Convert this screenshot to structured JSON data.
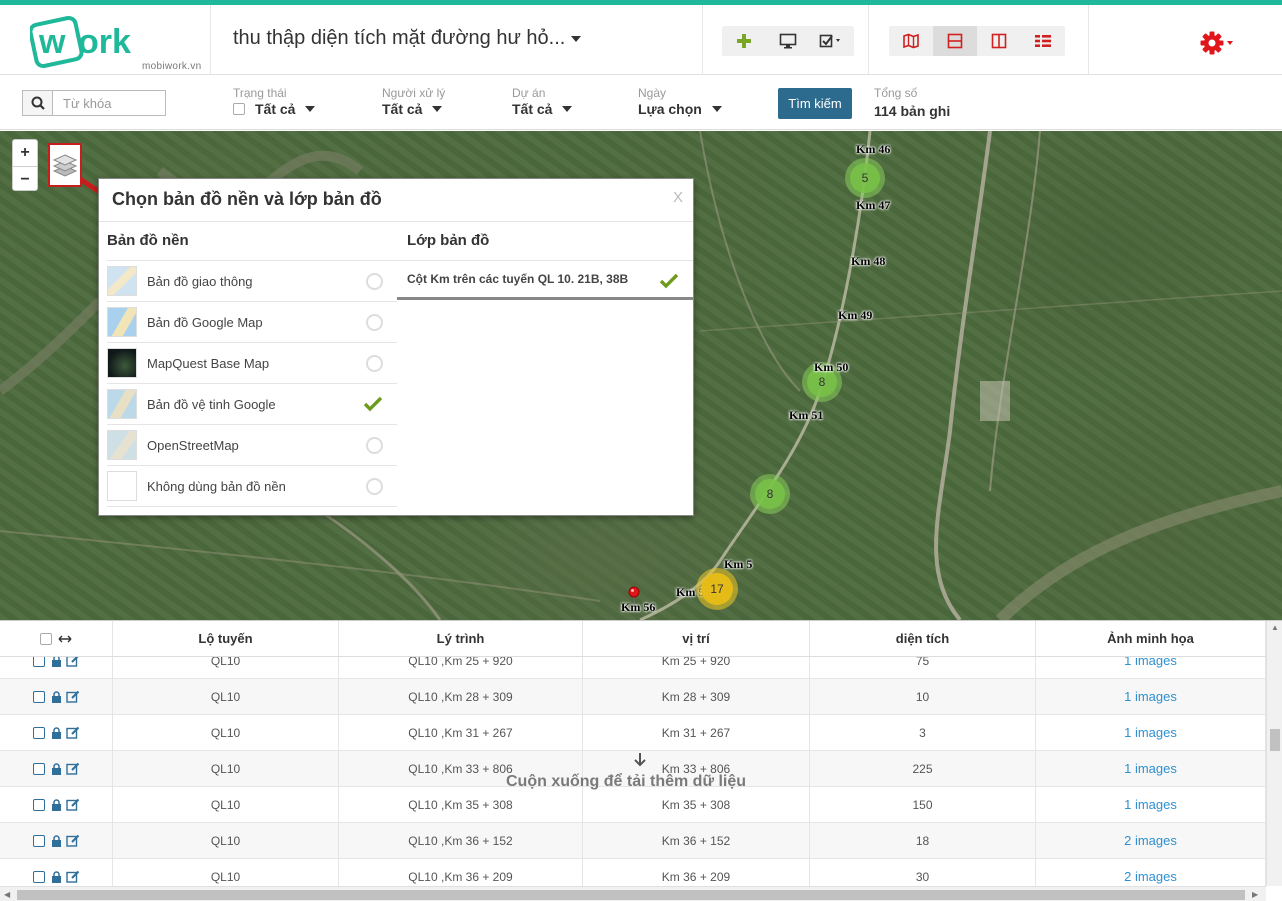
{
  "app": {
    "logo_text": "work",
    "logo_sub": "mobiwork.vn",
    "project_title": "thu thập diện tích mặt đường hư hỏ...",
    "accent": "#1fb89a",
    "settings_color": "#e0161b"
  },
  "filters": {
    "search_placeholder": "Từ khóa",
    "status": {
      "label": "Trạng thái",
      "value": "Tất cả"
    },
    "assignee": {
      "label": "Người xử lý",
      "value": "Tất cả"
    },
    "project": {
      "label": "Dự án",
      "value": "Tất cả"
    },
    "date": {
      "label": "Ngày",
      "value": "Lựa chọn"
    },
    "search_button": "Tìm kiếm",
    "total_label": "Tổng số",
    "total_value": "114 bản ghi"
  },
  "map": {
    "zoom_in": "+",
    "zoom_out": "−",
    "km_labels": [
      "Km 46",
      "Km 47",
      "Km 48",
      "Km 49",
      "Km 50",
      "Km 51",
      "Km 5",
      "Km 55",
      "Km 56"
    ],
    "clusters": [
      "5",
      "8",
      "8",
      "17"
    ]
  },
  "layer_popup": {
    "title": "Chọn bản đồ nền và lớp bản đồ",
    "close": "X",
    "base_header": "Bản đồ nền",
    "layer_header": "Lớp bản đồ",
    "base_maps": [
      {
        "name": "Bản đồ giao thông",
        "selected": false
      },
      {
        "name": "Bản đồ Google Map",
        "selected": false
      },
      {
        "name": "MapQuest Base Map",
        "selected": false
      },
      {
        "name": "Bản đồ vệ tinh Google",
        "selected": true
      },
      {
        "name": "OpenStreetMap",
        "selected": false
      },
      {
        "name": "Không dùng bản đồ nền",
        "selected": false
      }
    ],
    "layers": [
      {
        "name": "Cột Km trên các tuyến QL 10. 21B, 38B",
        "checked": true
      }
    ]
  },
  "table": {
    "headers": [
      "Lộ tuyến",
      "Lý trình",
      "vị trí",
      "diện tích",
      "Ảnh minh họa"
    ],
    "rows": [
      [
        "QL10",
        "QL10 ,Km 25 + 920",
        "Km 25 + 920",
        "75",
        "1 images"
      ],
      [
        "QL10",
        "QL10 ,Km 28 + 309",
        "Km 28 + 309",
        "10",
        "1 images"
      ],
      [
        "QL10",
        "QL10 ,Km 31 + 267",
        "Km 31 + 267",
        "3",
        "1 images"
      ],
      [
        "QL10",
        "QL10 ,Km 33 + 806",
        "Km 33 + 806",
        "225",
        "1 images"
      ],
      [
        "QL10",
        "QL10 ,Km 35 + 308",
        "Km 35 + 308",
        "150",
        "1 images"
      ],
      [
        "QL10",
        "QL10 ,Km 36 + 152",
        "Km 36 + 152",
        "18",
        "2 images"
      ],
      [
        "QL10",
        "QL10 ,Km 36 + 209",
        "Km 36 + 209",
        "30",
        "2 images"
      ]
    ],
    "load_more": "Cuộn xuống để tải thêm dữ liệu"
  }
}
